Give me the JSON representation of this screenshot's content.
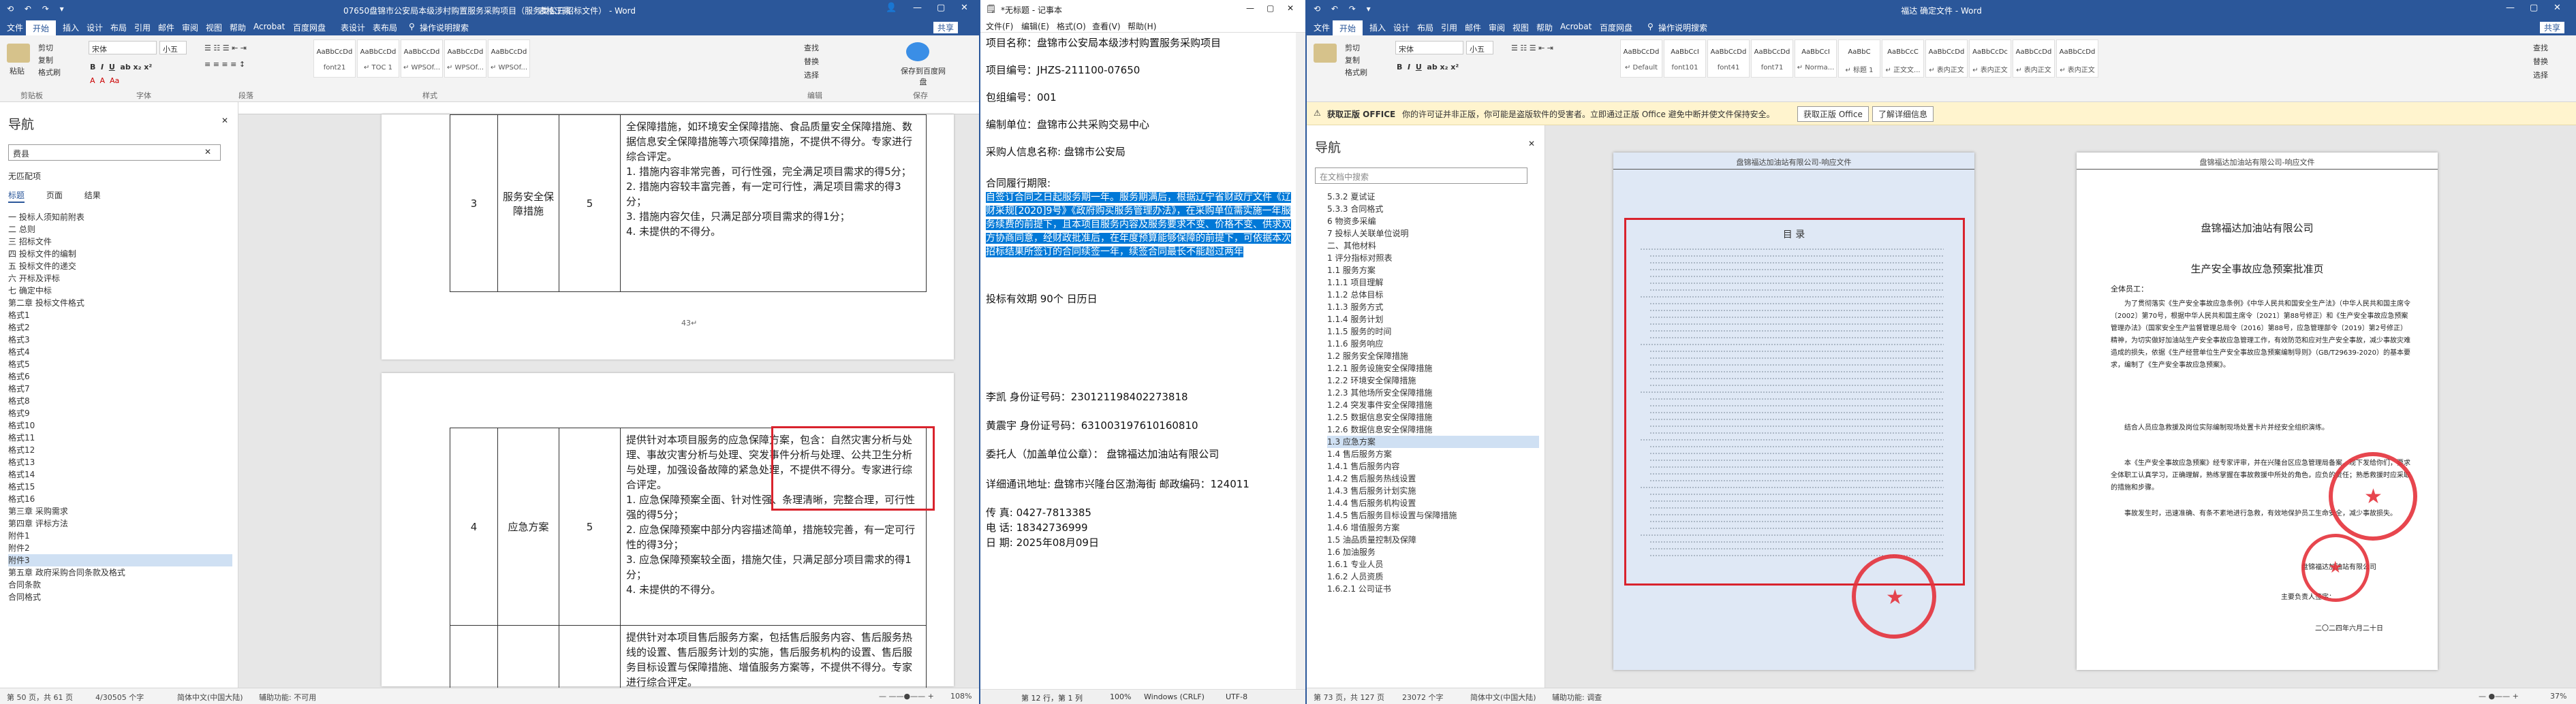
{
  "word1": {
    "title": "07650盘锦市公安局本级涉村购置服务采购项目（服务类公开招标文件） - Word",
    "tool_tab": "表格工具",
    "menu": [
      "文件",
      "开始",
      "插入",
      "设计",
      "布局",
      "引用",
      "邮件",
      "审阅",
      "视图",
      "帮助",
      "Acrobat",
      "百度网盘",
      "表设计",
      "表布局",
      "操作说明搜索",
      "共享"
    ],
    "ribbon": {
      "clipboard": [
        "粘贴",
        "剪切",
        "复制",
        "格式刷"
      ],
      "clipboard_group": "剪贴板",
      "font_name": "宋体",
      "font_size": "小五",
      "font_group": "字体",
      "para_group": "段落",
      "styles": [
        {
          "sample": "AaBbCcDd",
          "name": "font21"
        },
        {
          "sample": "AaBbCcDd",
          "name": "↵ TOC 1"
        },
        {
          "sample": "AaBbCcDd",
          "name": "↵ WPSOf..."
        },
        {
          "sample": "AaBbCcDd",
          "name": "↵ WPSOf..."
        },
        {
          "sample": "AaBbCcDd",
          "name": "↵ WPSOf..."
        }
      ],
      "styles_group": "样式",
      "edit": [
        "查找",
        "替换",
        "选择"
      ],
      "edit_group": "编辑",
      "baidu": "保存到百度网盘",
      "baidu_group": "保存"
    },
    "nav": {
      "heading": "导航",
      "search": "费县",
      "no_match": "无匹配项",
      "tabs": [
        "标题",
        "页面",
        "结果"
      ],
      "items": [
        "一 投标人须知前附表",
        "二 总则",
        "三 招标文件",
        "四 投标文件的编制",
        "五 投标文件的递交",
        "六 开标及评标",
        "七 确定中标",
        "第二章 投标文件格式",
        "格式1",
        "格式2",
        "格式3",
        "格式4",
        "格式5",
        "格式6",
        "格式7",
        "格式8",
        "格式9",
        "格式10",
        "格式11",
        "格式12",
        "格式13",
        "格式14",
        "格式15",
        "格式16",
        "第三章 采购需求",
        "第四章 评标方法",
        "附件1",
        "附件2",
        "附件3",
        "第五章 政府采购合同条款及格式",
        "合同条款",
        "合同格式"
      ],
      "selected": "附件3"
    },
    "table_upper": {
      "num": "3",
      "name": "服务安全保障措施",
      "score": "5",
      "text": "全保障措施，如环境安全保障措施、食品质量安全保障措施、数据信息安全保障措施等六项保障措施，不提供不得分。专家进行综合评定。\n1. 措施内容非常完善，可行性强，完全满足项目需求的得5分；\n2. 措施内容较丰富完善，有一定可行性，满足项目需求的得3分；\n3. 措施内容欠佳，只满足部分项目需求的得1分；\n4. 未提供的不得分。"
    },
    "table_lower": {
      "num": "4",
      "name": "应急方案",
      "score": "5",
      "text": "提供针对本项目服务的应急保障方案，包含：自然灾害分析与处理、事故灾害分析与处理、突发事件分析与处理、公共卫生分析与处理，加强设备故障的紧急处理，不提供不得分。专家进行综合评定。\n1. 应急保障预案全面、针对性强、条理清晰，完整合理，可行性强的得5分；\n2. 应急保障预案中部分内容描述简单，措施较完善，有一定可行性的得3分；\n3. 应急保障预案较全面，措施欠佳，只满足部分项目需求的得1分；\n4. 未提供的不得分。",
      "text2": "提供针对本项目售后服务方案，包括售后服务内容、售后服务热线的设置、售后服务计划的实施，售后服务机构的设置、售后服务目标设置与保障措施、增值服务方案等，不提供不得分。专家进行综合评定。"
    },
    "page_marker": "43↵",
    "status": {
      "page": "第 50 页，共 61 页",
      "words": "4/30505 个字",
      "lang": "简体中文(中国大陆)",
      "access": "辅助功能: 不可用",
      "zoom": "108%"
    }
  },
  "notepad": {
    "title": "*无标题 - 记事本",
    "menu": [
      "文件(F)",
      "编辑(E)",
      "格式(O)",
      "查看(V)",
      "帮助(H)"
    ],
    "lines": [
      "项目名称：盘锦市公安局本级涉村购置服务采购项目",
      "项目编号：JHZS-211100-07650",
      "包组编号：001",
      "编制单位：盘锦市公共采购交易中心",
      "采购人信息名称:      盘锦市公安局",
      "合同履行期限:"
    ],
    "selected_text": "自签订合同之日起服务期一年。服务期满后，根据辽宁省财政厅文件《辽财采规[2020]9号》《政府购买服务管理办法》，在采购单位需实施一年服务续费的前提下，且本项目服务内容及服务要求不变、价格不变、供求双方协商同意，经财政批准后，在年度预算能够保障的前提下，可依据本次招标结果所签订的合同续签一年，续签合同最长不能超过两年",
    "validity": "投标有效期               90个  日历日",
    "person1": "李凯   身份证号码：230121198402273818",
    "person2": "黄震宇  身份证号码：631003197610160810",
    "agent": "委托人（加盖单位公章）：   盘锦福达加油站有限公司",
    "address": "详细通讯地址:    盘锦市兴隆台区渤海街      邮政编码：124011",
    "fax": "传      真:      0427-7813385",
    "phone": "电      话:      18342736999",
    "date": "日      期:      2025年08月09日",
    "status": {
      "pos": "第 12 行，第 1 列",
      "zoom": "100%",
      "eol": "Windows (CRLF)",
      "enc": "UTF-8"
    }
  },
  "word2": {
    "title": "福达 确定文件 - Word",
    "menu": [
      "文件",
      "开始",
      "插入",
      "设计",
      "布局",
      "引用",
      "邮件",
      "审阅",
      "视图",
      "帮助",
      "Acrobat",
      "百度网盘",
      "操作说明搜索",
      "共享"
    ],
    "ribbon": {
      "font_name": "宋体",
      "font_size": "小五",
      "styles": [
        {
          "sample": "AaBbCcDd",
          "name": "↵ Default"
        },
        {
          "sample": "AaBbCcI",
          "name": "font101"
        },
        {
          "sample": "AaBbCcDd",
          "name": "font41"
        },
        {
          "sample": "AaBbCcDd",
          "name": "font71"
        },
        {
          "sample": "AaBbCcI",
          "name": "↵ Norma..."
        },
        {
          "sample": "AaBbC",
          "name": "↵ 标题 1"
        },
        {
          "sample": "AaBbCcC",
          "name": "↵ 正文文..."
        },
        {
          "sample": "AaBbCcDd",
          "name": "↵ 表内正文"
        },
        {
          "sample": "AaBbCcDc",
          "name": "↵ 表内正文"
        },
        {
          "sample": "AaBbCcDd",
          "name": "↵ 表内正文"
        },
        {
          "sample": "AaBbCcDd",
          "name": "↵ 表内正文"
        }
      ],
      "edit": [
        "查找",
        "替换",
        "选择"
      ]
    },
    "infobar": {
      "label": "获取正版 OFFICE",
      "text": "你的许可证并非正版，你可能是盗版软件的受害者。立即通过正版 Office 避免中断并使文件保持安全。",
      "btn1": "获取正版 Office",
      "btn2": "了解详细信息"
    },
    "nav": {
      "heading": "导航",
      "search_placeholder": "在文档中搜索",
      "items": [
        "5.3.2 夏试证",
        "5.3.3 合同格式",
        "6 物资多采编",
        "7 投标人关联单位说明",
        "二、其他材料",
        "1 评分指标对照表",
        "1.1 服务方案",
        "1.1.1 项目理解",
        "1.1.2 总体目标",
        "1.1.3 服务方式",
        "1.1.4 服务计划",
        "1.1.5 服务的时间",
        "1.1.6 服务响应",
        "1.2 服务安全保障措施",
        "1.2.1 服务设施安全保障措施",
        "1.2.2 环境安全保障措施",
        "1.2.3 其他场所安全保障措施",
        "1.2.4 突发事件安全保障措施",
        "1.2.5 数据信息安全保障措施",
        "1.2.6 数据信息安全保障措施",
        "1.3 应急方案",
        "1.4 售后服务方案",
        "1.4.1 售后服务内容",
        "1.4.2 售后服务热线设置",
        "1.4.3 售后服务计划实施",
        "1.4.4 售后服务机构设置",
        "1.4.5 售后服务目标设置与保障措施",
        "1.4.6 增值服务方案",
        "1.5 油品质量控制及保障",
        "1.6 加油服务",
        "1.6.1 专业人员",
        "1.6.2 人员资质",
        "1.6.2.1 公司证书"
      ],
      "selected": "1.3 应急方案"
    },
    "scan1": {
      "header": "盘锦福达加油站有限公司-响应文件",
      "toc_title": "目 录"
    },
    "scan2": {
      "header": "盘锦福达加油站有限公司-响应文件",
      "company": "盘锦福达加油站有限公司",
      "title": "生产安全事故应急预案批准页",
      "greeting": "全体员工：",
      "para1": "为了贯彻落实《生产安全事故应急条例》《中华人民共和国安全生产法》（中华人民共和国主席令〔2002〕第70号，根据中华人民共和国主席令〔2021〕第88号修正）和《生产安全事故应急预案管理办法》（国家安全生产监督管理总局令〔2016〕第88号，应急管理部令〔2019〕第2号修正）精神，为切实做好加油站生产安全事故应急管理工作，有效防范和应对生产安全事故，减少事故灾难造成的损失，依据《生产经营单位生产安全事故应急预案编制导则》（GB/T29639-2020）的基本要求，编制了《生产安全事故应急预案》。",
      "para2": "结合人员应急救援及岗位实际编制现场处置卡片并经安全组织演练。",
      "para3": "本《生产安全事故应急预案》经专家评审，并在兴隆台区应急管理局备案。现下发给你们，要求全体职工认真学习，正确理解，熟练掌握在事故救援中所处的角色，应负的责任；熟悉救援时应采取的措施和步骤。",
      "para4": "事故发生时，迅速准确、有条不紊地进行急救，有效地保护员工生命安全，减少事故损失。",
      "sign": "盘锦福达加油站有限公司",
      "sign2": "主要负责人签字：",
      "date": "二〇二四年六月二十日"
    },
    "status": {
      "page": "第 73 页，共 127 页",
      "words": "23072 个字",
      "lang": "简体中文(中国大陆)",
      "access": "辅助功能: 调查",
      "zoom": "37%"
    }
  }
}
